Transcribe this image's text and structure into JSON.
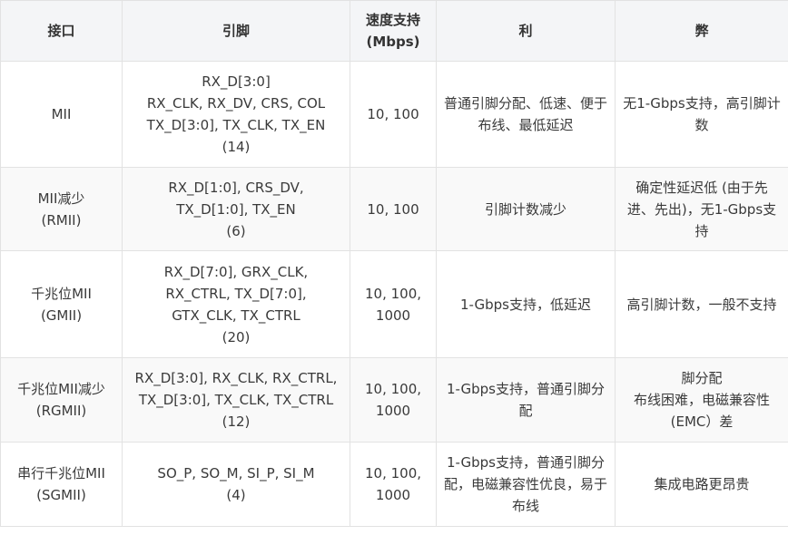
{
  "table": {
    "headers": [
      "接口",
      "引脚",
      "速度支持",
      "(Mbps)",
      "利",
      "弊"
    ],
    "rows": [
      {
        "interface": [
          "MII"
        ],
        "pins": [
          "RX_D[3:0]",
          "RX_CLK, RX_DV, CRS, COL",
          "TX_D[3:0], TX_CLK, TX_EN",
          "(14)"
        ],
        "speed": [
          "10, 100"
        ],
        "pros": [
          "普通引脚分配、低速、便于布线、最低延迟"
        ],
        "cons": [
          "无1-Gbps支持，高引脚计数"
        ]
      },
      {
        "interface": [
          "MII减少",
          "(RMII)"
        ],
        "pins": [
          "RX_D[1:0], CRS_DV,",
          "TX_D[1:0], TX_EN",
          "(6)"
        ],
        "speed": [
          "10, 100"
        ],
        "pros": [
          "引脚计数减少"
        ],
        "cons": [
          "确定性延迟低 (由于先进、先出)，无1-Gbps支持"
        ]
      },
      {
        "interface": [
          "千兆位MII",
          "(GMII)"
        ],
        "pins": [
          "RX_D[7:0], GRX_CLK,",
          "RX_CTRL, TX_D[7:0],",
          "GTX_CLK, TX_CTRL",
          "(20)"
        ],
        "speed": [
          "10, 100,",
          "1000"
        ],
        "pros": [
          "1-Gbps支持，低延迟"
        ],
        "cons": [
          "高引脚计数，一般不支持"
        ]
      },
      {
        "interface": [
          "千兆位MII减少",
          "(RGMII)"
        ],
        "pins": [
          "RX_D[3:0], RX_CLK, RX_CTRL,",
          "TX_D[3:0], TX_CLK, TX_CTRL",
          "(12)"
        ],
        "speed": [
          "10, 100,",
          "1000"
        ],
        "pros": [
          "1-Gbps支持，普通引脚分配"
        ],
        "cons": [
          "脚分配",
          "布线困难，电磁兼容性",
          "(EMC）差"
        ]
      },
      {
        "interface": [
          "串行千兆位MII",
          "(SGMII)"
        ],
        "pins": [
          "SO_P, SO_M, SI_P, SI_M",
          "(4)"
        ],
        "speed": [
          "10, 100,",
          "1000"
        ],
        "pros": [
          "1-Gbps支持，普通引脚分配，电磁兼容性优良，易于布线"
        ],
        "cons": [
          "集成电路更昂贵"
        ]
      }
    ]
  }
}
